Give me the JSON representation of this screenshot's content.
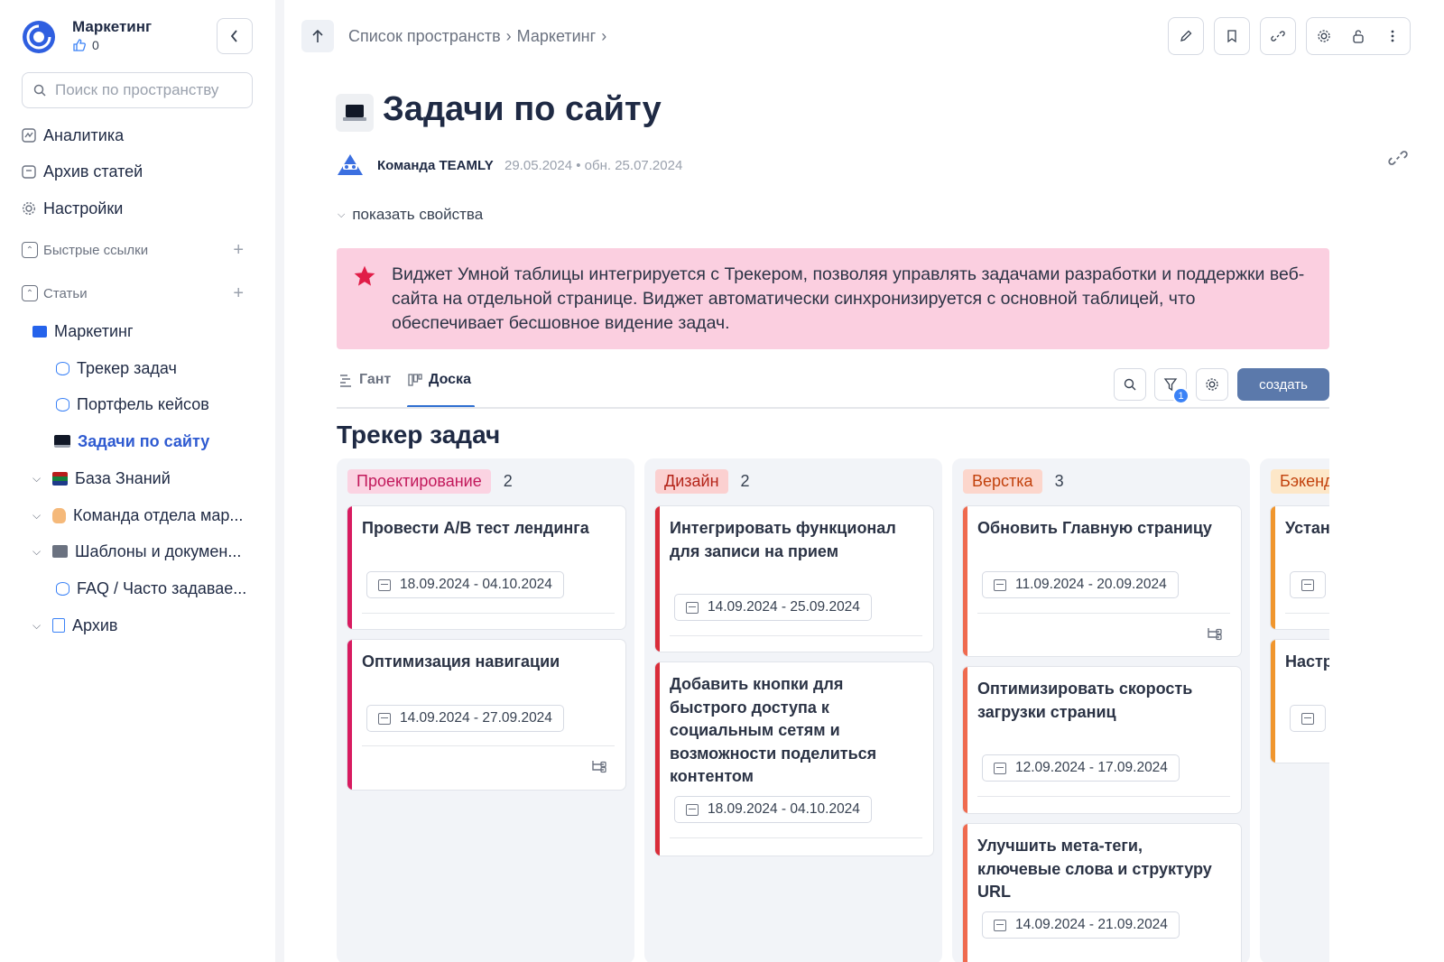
{
  "workspace": {
    "title": "Маркетинг",
    "likes": "0"
  },
  "search": {
    "placeholder": "Поиск по пространству"
  },
  "sidebar": {
    "nav": [
      "Аналитика",
      "Архив статей",
      "Настройки"
    ],
    "quick_links": "Быстрые ссылки",
    "articles": "Статьи",
    "tree": [
      {
        "label": "Маркетинг",
        "icon": "folder-icon"
      },
      {
        "label": "Трекер задач",
        "icon": "database-icon"
      },
      {
        "label": "Портфель кейсов",
        "icon": "database-icon"
      },
      {
        "label": "Задачи по сайту",
        "icon": "laptop-icon",
        "active": true
      },
      {
        "label": "База Знаний",
        "icon": "books-icon"
      },
      {
        "label": "Команда отдела мар...",
        "icon": "hand-icon"
      },
      {
        "label": "Шаблоны и докумен...",
        "icon": "folder-icon"
      },
      {
        "label": "FAQ / Часто задавае...",
        "icon": "database-icon"
      },
      {
        "label": "Архив",
        "icon": "document-icon"
      }
    ]
  },
  "breadcrumb": {
    "items": [
      "Список пространств",
      "Маркетинг"
    ],
    "separator": "›"
  },
  "page": {
    "title": "Задачи по сайту",
    "author": "Команда TEAMLY",
    "dates": "29.05.2024 • обн. 25.07.2024",
    "props_toggle": "показать свойства"
  },
  "callout": {
    "text": "Виджет Умной таблицы интегрируется с Трекером, позволяя управлять задачами разработки и поддержки веб-сайта на отдельной странице. Виджет автоматически синхронизируется с основной таблицей, что обеспечивает бесшовное видение задач.",
    "bg_color": "#fbcfe0",
    "icon": "star-icon"
  },
  "tabs": [
    {
      "label": "Гант"
    },
    {
      "label": "Доска",
      "active": true
    }
  ],
  "toolbar": {
    "filter_badge": "1",
    "create_label": "создать"
  },
  "board": {
    "title": "Трекер задач",
    "columns": [
      {
        "name": "Проектирование",
        "count": "2",
        "tag_bg": "#fbd3e2",
        "tag_color": "#c2185b",
        "bar_color": "#d81b60",
        "cards": [
          {
            "title": "Провести A/B тест лендинга",
            "dates": "18.09.2024 - 04.10.2024"
          },
          {
            "title": "Оптимизация навигации",
            "dates": "14.09.2024 - 27.09.2024",
            "subtasks": true
          }
        ]
      },
      {
        "name": "Дизайн",
        "count": "2",
        "tag_bg": "#fbd0d0",
        "tag_color": "#b42318",
        "bar_color": "#d92d3a",
        "cards": [
          {
            "title": "Интегрировать функционал для записи на прием",
            "dates": "14.09.2024 - 25.09.2024"
          },
          {
            "title": "Добавить кнопки для быстрого доступа к социальным сетям и возможности поделиться контентом",
            "dates": "18.09.2024 - 04.10.2024"
          }
        ]
      },
      {
        "name": "Верстка",
        "count": "3",
        "tag_bg": "#fcd6cc",
        "tag_color": "#c2410c",
        "bar_color": "#ef6a4f",
        "cards": [
          {
            "title": "Обновить Главную страницу",
            "dates": "11.09.2024 - 20.09.2024",
            "subtasks": true
          },
          {
            "title": "Оптимизировать скорость загрузки страниц",
            "dates": "12.09.2024 - 17.09.2024"
          },
          {
            "title": "Улучшить мета-теги, ключевые слова и структуру URL",
            "dates": "14.09.2024 - 21.09.2024"
          }
        ]
      },
      {
        "name": "Бэкенд",
        "count": "",
        "tag_bg": "#fde7c8",
        "tag_color": "#c2410c",
        "bar_color": "#f0962e",
        "cards": [
          {
            "title": "Установить сертификат",
            "dates": ""
          },
          {
            "title": "Настроить аналитику",
            "dates": ""
          }
        ]
      }
    ]
  },
  "colors": {
    "accent": "#2f6fd1",
    "create_button": "#5b79ab",
    "active_nav": "#2f5bd1"
  }
}
